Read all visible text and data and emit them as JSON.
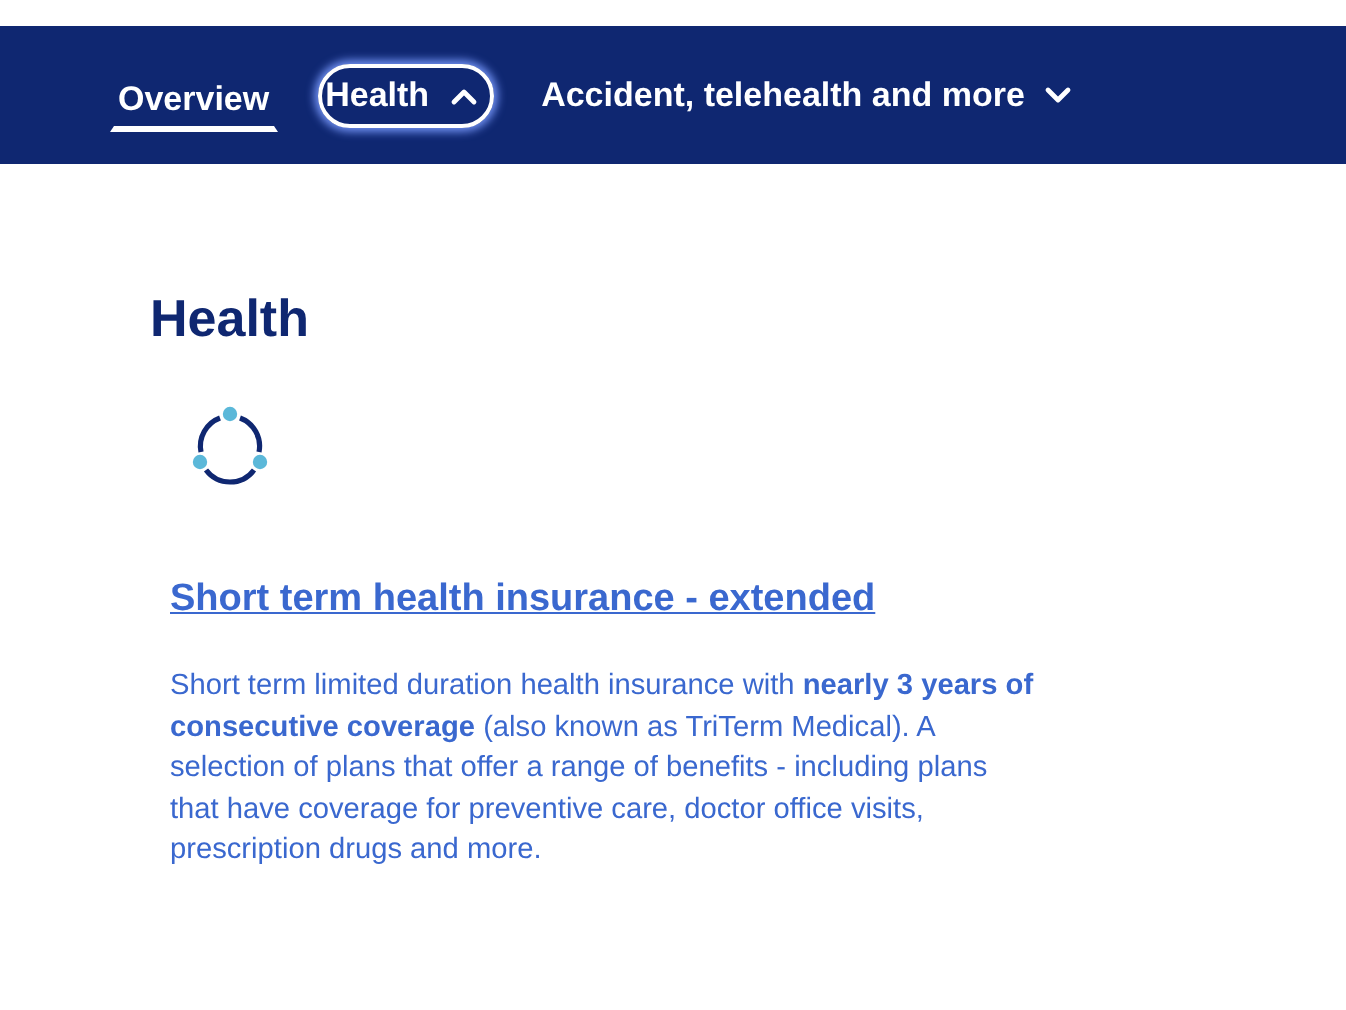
{
  "nav": {
    "tabs": [
      {
        "label": "Overview",
        "kind": "link",
        "selected": true
      },
      {
        "label": "Health",
        "kind": "dropdown",
        "selected": false,
        "expanded": true
      },
      {
        "label": "Accident, telehealth and more",
        "kind": "dropdown",
        "selected": false,
        "expanded": false
      }
    ]
  },
  "section": {
    "title": "Health",
    "items": [
      {
        "link": "Short term health insurance - extended",
        "description": "Short term limited duration health insurance with **nearly 3 years of consecutive coverage** (also known as TriTerm Medical). A selection of plans that offer a range of benefits - including plans that have coverage for preventive care, doctor office visits, prescription drugs and more."
      }
    ]
  }
}
